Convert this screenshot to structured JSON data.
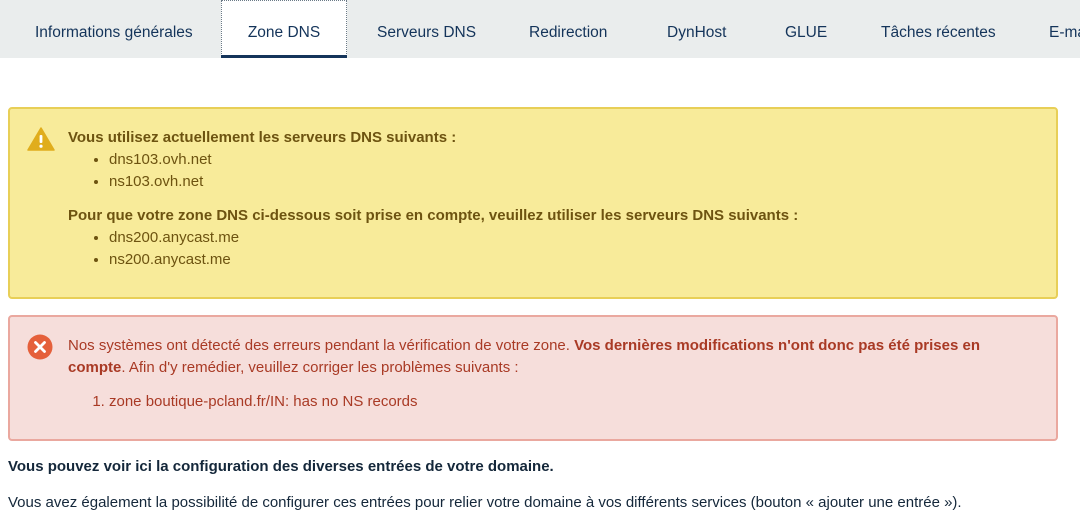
{
  "tabs": [
    {
      "label": "Informations générales",
      "active": false
    },
    {
      "label": "Zone DNS",
      "active": true
    },
    {
      "label": "Serveurs DNS",
      "active": false
    },
    {
      "label": "Redirection",
      "active": false
    },
    {
      "label": "DynHost",
      "active": false
    },
    {
      "label": "GLUE",
      "active": false
    },
    {
      "label": "Tâches récentes",
      "active": false
    },
    {
      "label": "E-ma",
      "active": false
    }
  ],
  "warning": {
    "icon": "warning-icon",
    "current_title": "Vous utilisez actuellement les serveurs DNS suivants :",
    "current_servers": [
      "dns103.ovh.net",
      "ns103.ovh.net"
    ],
    "required_title": "Pour que votre zone DNS ci-dessous soit prise en compte, veuillez utiliser les serveurs DNS suivants :",
    "required_servers": [
      "dns200.anycast.me",
      "ns200.anycast.me"
    ]
  },
  "error": {
    "icon": "error-icon",
    "text_before": "Nos systèmes ont détecté des erreurs pendant la vérification de votre zone. ",
    "text_bold": "Vos dernières modifications n'ont donc pas été prises en compte",
    "text_after": ". Afin d'y remédier, veuillez corriger les problèmes suivants :",
    "problems": [
      "zone boutique-pcland.fr/IN: has no NS records"
    ]
  },
  "description": {
    "line1": "Vous pouvez voir ici la configuration des diverses entrées de votre domaine.",
    "line2": "Vous avez également la possibilité de configurer ces entrées pour relier votre domaine à vos différents services (bouton « ajouter une entrée »)."
  },
  "colors": {
    "brand": "#14345a",
    "warning_bg": "#f8eb9a",
    "error_bg": "#f6dedb",
    "error_icon": "#e5603b"
  }
}
